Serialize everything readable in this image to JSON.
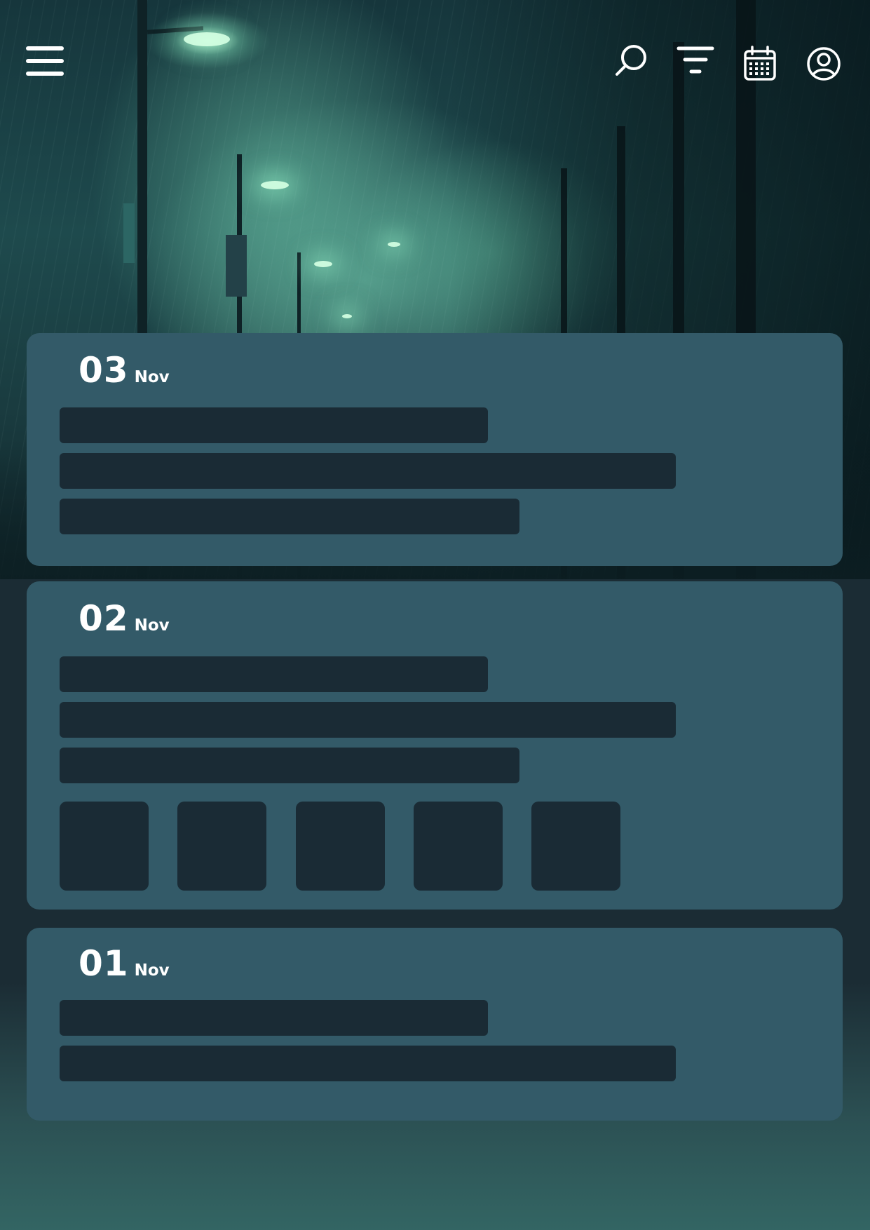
{
  "header": {
    "icons": {
      "menu": "menu-icon",
      "search": "search-icon",
      "filter": "filter-icon",
      "calendar": "calendar-icon",
      "profile": "user-icon"
    }
  },
  "entries": [
    {
      "day": "03",
      "month": "Nov"
    },
    {
      "day": "02",
      "month": "Nov"
    },
    {
      "day": "01",
      "month": "Nov"
    }
  ],
  "colors": {
    "card": "#335a68",
    "placeholder": "#1a2b35",
    "icon": "#ffffff"
  }
}
